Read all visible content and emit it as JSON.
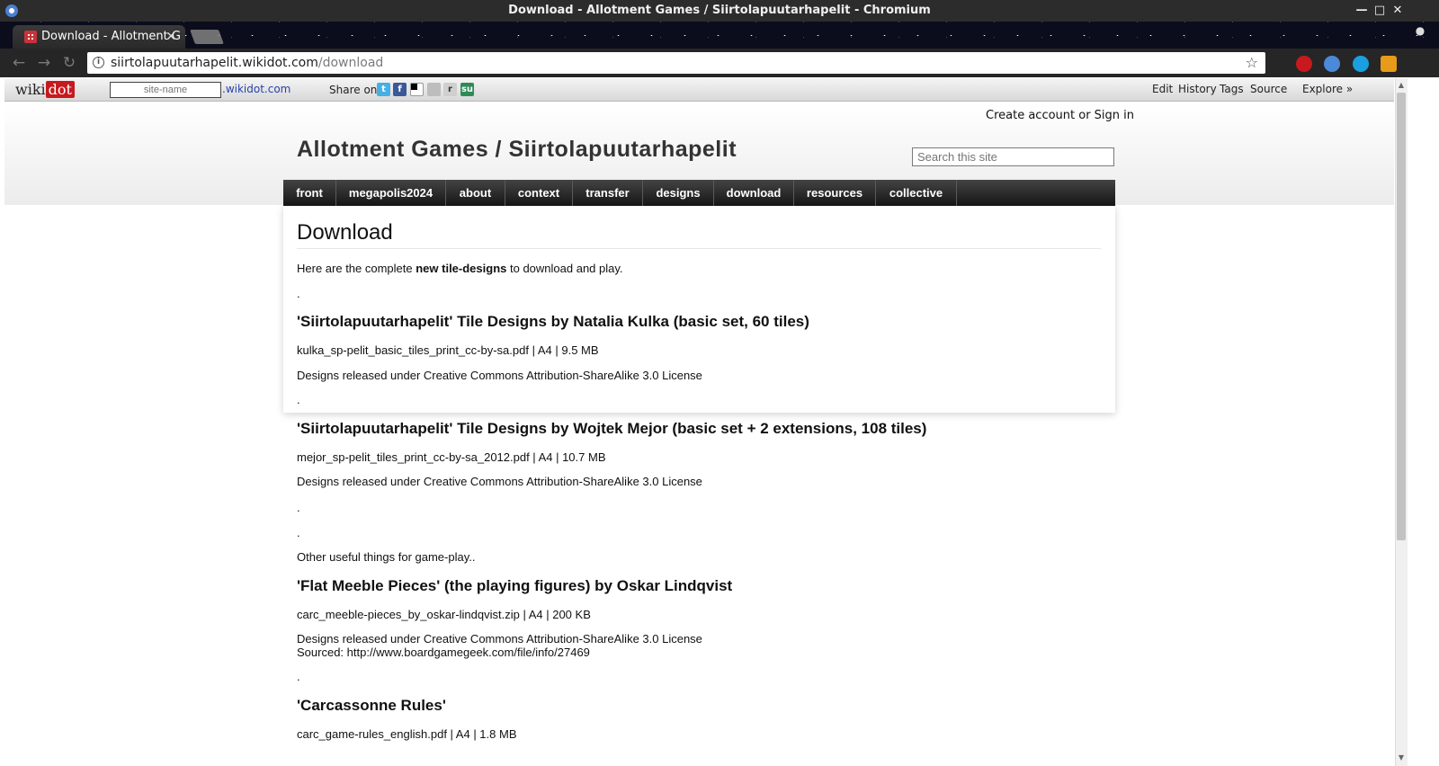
{
  "window": {
    "title": "Download - Allotment Games / Siirtolapuutarhapelit - Chromium"
  },
  "browser": {
    "tab_title": "Download - Allotment G",
    "url_host": "siirtolapuutarhapelit.wikidot.com",
    "url_path": "/download"
  },
  "wikidot_bar": {
    "logo_a": "wiki",
    "logo_b": "dot",
    "site_name_placeholder": "site-name",
    "domain_suffix": ".wikidot.com",
    "share_label": "Share on",
    "menu": [
      "Edit",
      "History",
      "Tags",
      "Source",
      "Explore »"
    ]
  },
  "header": {
    "login": "Create account or Sign in",
    "site_title": "Allotment Games / Siirtolapuutarhapelit",
    "search_placeholder": "Search this site"
  },
  "nav": [
    "front",
    "megapolis2024",
    "about",
    "context",
    "transfer",
    "designs",
    "download",
    "resources",
    "collective"
  ],
  "page": {
    "heading": "Download",
    "intro_before": "Here are the complete ",
    "intro_bold": "new tile-designs",
    "intro_after": " to download and play.",
    "dot": ".",
    "section1_title": "'Siirtolapuutarhapelit' Tile Designs by Natalia Kulka (basic set, 60 tiles)",
    "section1_file": "kulka_sp-pelit_basic_tiles_print_cc-by-sa.pdf | A4 | 9.5 MB",
    "license": "Designs released under Creative Commons Attribution-ShareAlike 3.0 License",
    "section2_title": "'Siirtolapuutarhapelit' Tile Designs by Wojtek Mejor (basic set + 2 extensions, 108 tiles)",
    "section2_file": "mejor_sp-pelit_tiles_print_cc-by-sa_2012.pdf | A4 | 10.7 MB",
    "other_things": "Other useful things for game-play..",
    "section3_title": "'Flat Meeble Pieces' (the playing figures) by Oskar Lindqvist",
    "section3_file": "carc_meeble-pieces_by_oskar-lindqvist.zip | A4 | 200 KB",
    "section3_source": "Sourced: http://www.boardgamegeek.com/file/info/27469",
    "section4_title": "'Carcassonne Rules'",
    "section4_file": "carc_game-rules_english.pdf | A4 | 1.8 MB"
  }
}
